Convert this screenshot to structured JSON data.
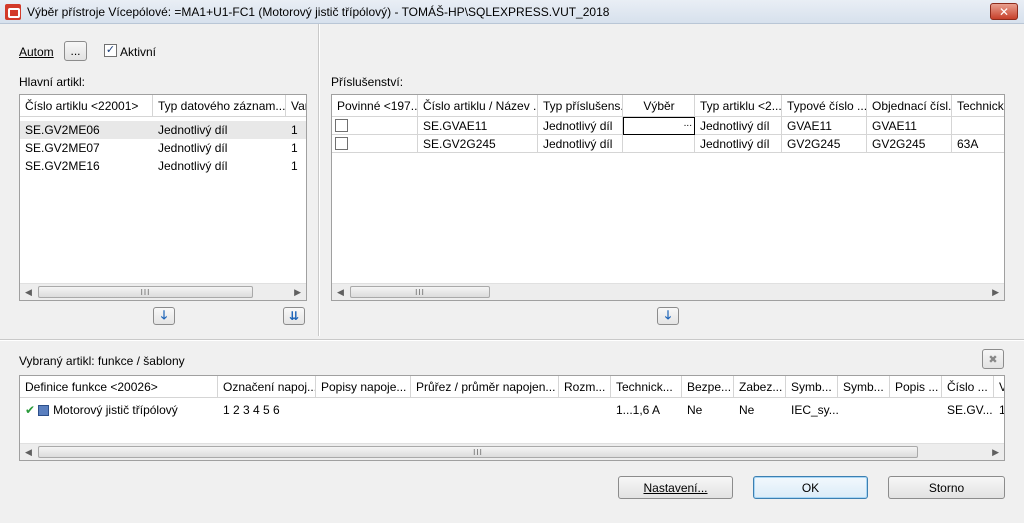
{
  "window": {
    "title": "Výběr přístroje Vícepólové: =MA1+U1-FC1 (Motorový jistič třípólový) - TOMÁŠ-HP\\SQLEXPRESS.VUT_2018",
    "close": "✕"
  },
  "top": {
    "autom_label": "Autom",
    "more_button": "...",
    "aktivni_label": "Aktivní",
    "aktivni_checked": true
  },
  "main_article": {
    "label": "Hlavní artikl:",
    "columns": [
      "Číslo artiklu <22001>",
      "Typ datového záznam...",
      "Var"
    ],
    "rows": [
      [
        "SE.GV2ME06",
        "Jednotlivý díl",
        "1"
      ],
      [
        "SE.GV2ME07",
        "Jednotlivý díl",
        "1"
      ],
      [
        "SE.GV2ME16",
        "Jednotlivý díl",
        "1"
      ]
    ]
  },
  "accessories": {
    "label": "Příslušenství:",
    "columns": [
      "Povinné <197...",
      "Číslo artiklu / Název ...",
      "Typ příslušens...",
      "Výběr",
      "Typ artiklu <2...",
      "Typové číslo ...",
      "Objednací čísl...",
      "Technické"
    ],
    "rows": [
      [
        "",
        "SE.GVAE11",
        "Jednotlivý díl",
        "...",
        "Jednotlivý díl",
        "GVAE11",
        "GVAE11",
        ""
      ],
      [
        "",
        "SE.GV2G245",
        "Jednotlivý díl",
        "",
        "Jednotlivý díl",
        "GV2G245",
        "GV2G245",
        "63A"
      ]
    ]
  },
  "selected": {
    "label": "Vybraný artikl: funkce / šablony",
    "close": "✖",
    "columns": [
      "Definice funkce <20026>",
      "Označení napoj...",
      "Popisy napoje...",
      "Průřez / průměr napojen...",
      "Rozm...",
      "Technick...",
      "Bezpe...",
      "Zabez...",
      "Symb...",
      "Symb...",
      "Popis ...",
      "Číslo ...",
      "V"
    ],
    "rows": [
      [
        "Motorový jistič třípólový",
        "1 2 3 4 5 6",
        "",
        "",
        "",
        "1...1,6 A",
        "Ne",
        "Ne",
        "IEC_sy...",
        "",
        "",
        "SE.GV...",
        "1"
      ]
    ]
  },
  "buttons": {
    "nastaveni": "Nastavení...",
    "ok": "OK",
    "storno": "Storno"
  },
  "scroll": {
    "grip": "III"
  }
}
